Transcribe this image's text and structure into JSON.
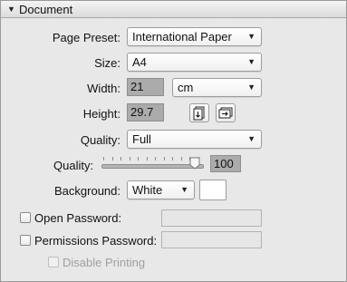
{
  "panel": {
    "title": "Document"
  },
  "page_preset": {
    "label": "Page Preset:",
    "value": "International Paper"
  },
  "size": {
    "label": "Size:",
    "value": "A4"
  },
  "width": {
    "label": "Width:",
    "value": "21"
  },
  "units": {
    "value": "cm"
  },
  "height": {
    "label": "Height:",
    "value": "29.7"
  },
  "quality_preset": {
    "label": "Quality:",
    "value": "Full"
  },
  "quality_slider": {
    "label": "Quality:",
    "value": "100",
    "level": 1.0
  },
  "background": {
    "label": "Background:",
    "value": "White",
    "swatch_color": "#ffffff"
  },
  "open_password": {
    "label": "Open Password:",
    "checked": false,
    "value": ""
  },
  "permissions_password": {
    "label": "Permissions Password:",
    "checked": false,
    "value": ""
  },
  "disable_printing": {
    "label": "Disable Printing",
    "checked": false,
    "enabled": false
  },
  "icons": {
    "section_toggle": "disclosure-triangle-icon",
    "portrait": "portrait-orientation-icon",
    "landscape": "landscape-orientation-icon"
  }
}
